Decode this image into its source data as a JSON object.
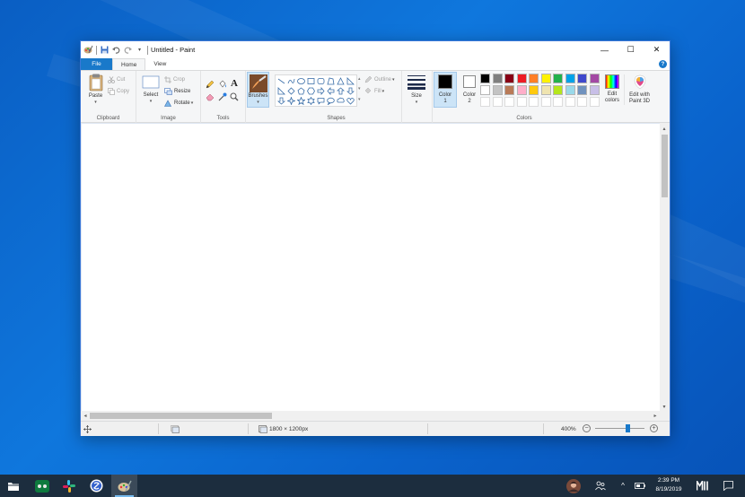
{
  "window": {
    "title": "Untitled - Paint",
    "minimize": "—",
    "maximize": "☐",
    "close": "✕"
  },
  "tabs": {
    "file": "File",
    "home": "Home",
    "view": "View",
    "help": "?"
  },
  "ribbon": {
    "clipboard": {
      "label": "Clipboard",
      "paste": "Paste",
      "cut": "Cut",
      "copy": "Copy"
    },
    "image": {
      "label": "Image",
      "select": "Select",
      "crop": "Crop",
      "resize": "Resize",
      "rotate": "Rotate"
    },
    "tools": {
      "label": "Tools"
    },
    "brushes": "Brushes",
    "shapes": {
      "label": "Shapes",
      "outline": "Outline",
      "fill": "Fill"
    },
    "size": "Size",
    "colors": {
      "label": "Colors",
      "color1_line1": "Color",
      "color1_line2": "1",
      "color2_line1": "Color",
      "color2_line2": "2",
      "edit_line1": "Edit",
      "edit_line2": "colors",
      "paint3d_line1": "Edit with",
      "paint3d_line2": "Paint 3D",
      "palette_row1": [
        "#000000",
        "#7f7f7f",
        "#880015",
        "#ed1c24",
        "#ff7f27",
        "#fff200",
        "#22b14c",
        "#00a2e8",
        "#3f48cc",
        "#a349a4"
      ],
      "palette_row2": [
        "#ffffff",
        "#c3c3c3",
        "#b97a57",
        "#ffaec9",
        "#ffc90e",
        "#efe4b0",
        "#b5e61d",
        "#99d9ea",
        "#7092be",
        "#c8bfe7"
      ]
    }
  },
  "status": {
    "dimensions": "1800 × 1200px",
    "zoom": "400%",
    "zoom_out": "−",
    "zoom_in": "+"
  },
  "clock": {
    "time": "2:39 PM",
    "date": "8/19/2019"
  },
  "accent": "#1979ca"
}
